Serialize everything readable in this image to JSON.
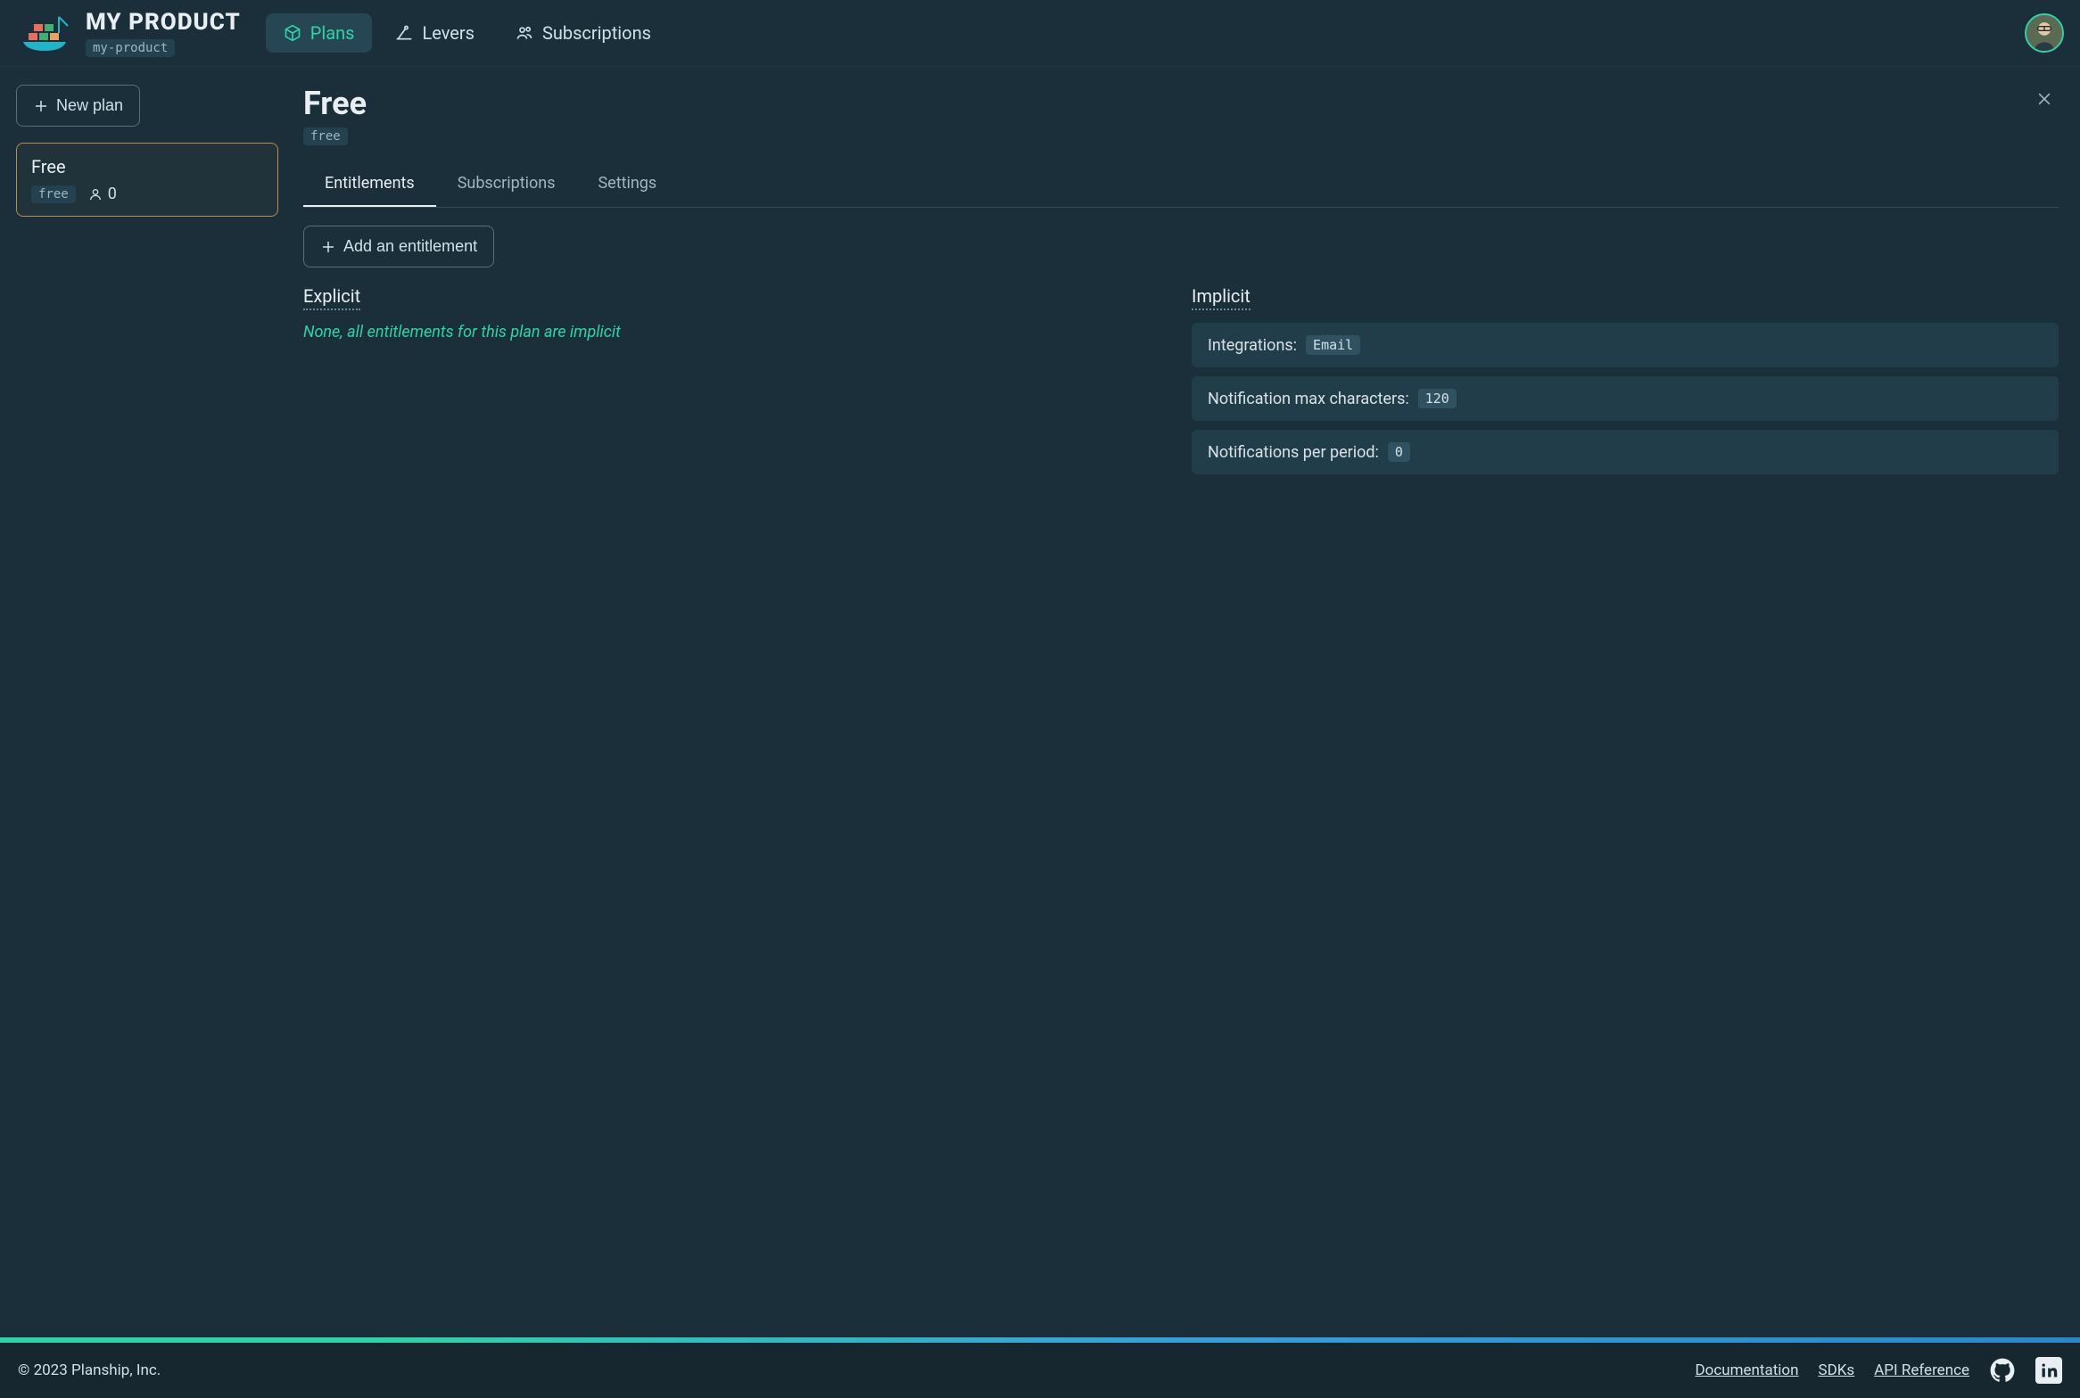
{
  "header": {
    "product_name": "MY PRODUCT",
    "product_slug": "my-product",
    "nav": {
      "plans": "Plans",
      "levers": "Levers",
      "subscriptions": "Subscriptions"
    }
  },
  "sidebar": {
    "new_plan_label": "New plan",
    "plans": [
      {
        "name": "Free",
        "slug": "free",
        "user_count": "0"
      }
    ]
  },
  "content": {
    "title": "Free",
    "slug": "free",
    "tabs": {
      "entitlements": "Entitlements",
      "subscriptions": "Subscriptions",
      "settings": "Settings"
    },
    "add_entitlement_label": "Add an entitlement",
    "explicit_heading": "Explicit",
    "explicit_empty": "None, all entitlements for this plan are implicit",
    "implicit_heading": "Implicit",
    "implicit_items": [
      {
        "label": "Integrations:",
        "value": "Email"
      },
      {
        "label": "Notification max characters:",
        "value": "120"
      },
      {
        "label": "Notifications per period:",
        "value": "0"
      }
    ]
  },
  "footer": {
    "copyright": "© 2023 Planship, Inc.",
    "links": {
      "documentation": "Documentation",
      "sdks": "SDKs",
      "api_reference": "API Reference"
    }
  }
}
